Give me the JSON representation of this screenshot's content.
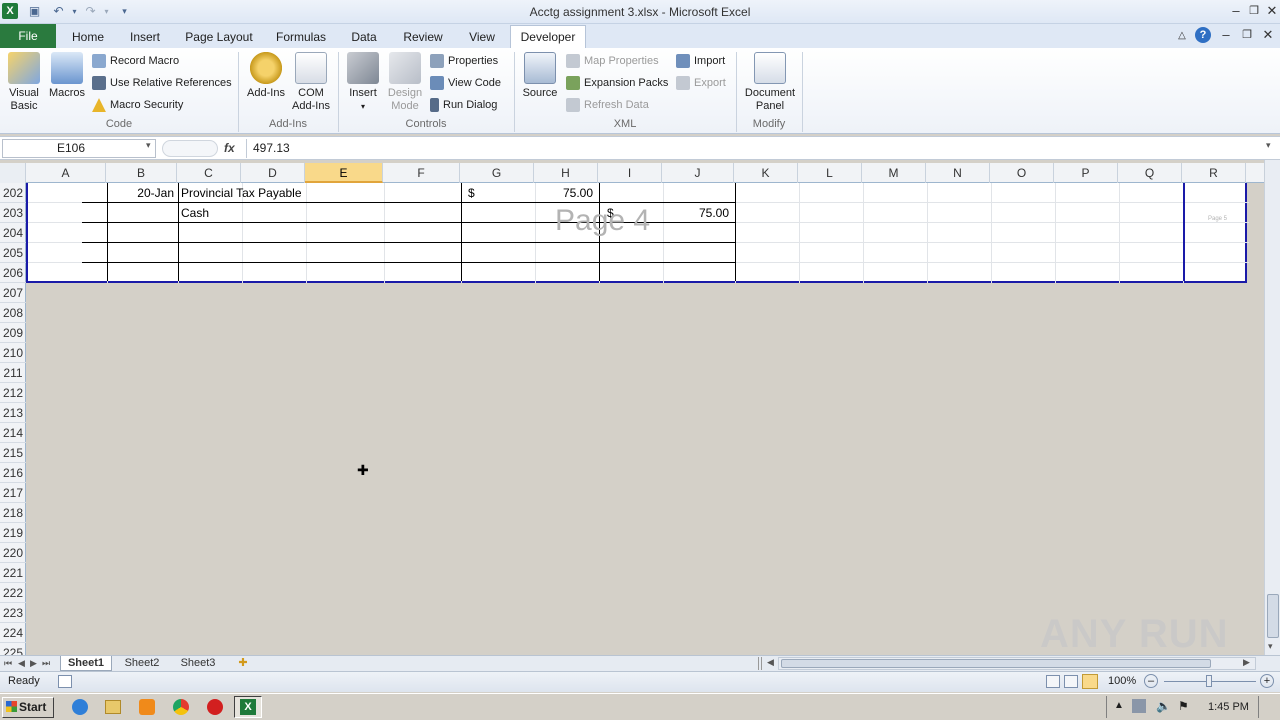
{
  "window": {
    "title": "Acctg assignment 3.xlsx - Microsoft Excel"
  },
  "tabs": [
    "File",
    "Home",
    "Insert",
    "Page Layout",
    "Formulas",
    "Data",
    "Review",
    "View",
    "Developer"
  ],
  "ribbon": {
    "code": {
      "label": "Code",
      "visual_basic": "Visual Basic",
      "macros": "Macros",
      "record_macro": "Record Macro",
      "relative_refs": "Use Relative References",
      "macro_security": "Macro Security"
    },
    "addins": {
      "label": "Add-Ins",
      "addins": "Add-Ins",
      "com_addins": "COM Add-Ins"
    },
    "controls": {
      "label": "Controls",
      "insert": "Insert",
      "design_mode": "Design Mode",
      "properties": "Properties",
      "view_code": "View Code",
      "run_dialog": "Run Dialog"
    },
    "xml": {
      "label": "XML",
      "source": "Source",
      "map_properties": "Map Properties",
      "expansion_packs": "Expansion Packs",
      "refresh_data": "Refresh Data",
      "import": "Import",
      "export": "Export"
    },
    "modify": {
      "label": "Modify",
      "document_panel": "Document Panel"
    }
  },
  "formula_bar": {
    "name_box": "E106",
    "fx": "fx",
    "value": "497.13"
  },
  "columns": [
    "A",
    "B",
    "C",
    "D",
    "E",
    "F",
    "G",
    "H",
    "I",
    "J",
    "K",
    "L",
    "M",
    "N",
    "O",
    "P",
    "Q",
    "R"
  ],
  "selected_column": "E",
  "rows": [
    "202",
    "203",
    "204",
    "205",
    "206",
    "207",
    "208",
    "209",
    "210",
    "211",
    "212",
    "213",
    "214",
    "215",
    "216",
    "217",
    "218",
    "219",
    "220",
    "221",
    "222",
    "223",
    "224",
    "225"
  ],
  "cells": {
    "b202": "20-Jan",
    "c202": "Provincial Tax Payable",
    "g202": "$",
    "h202": "75.00",
    "c203": "Cash",
    "i203": "$",
    "j203": "75.00"
  },
  "page_watermark": "Page 4",
  "page_watermark_small": "Page 5",
  "sheets": [
    "Sheet1",
    "Sheet2",
    "Sheet3"
  ],
  "active_sheet": "Sheet1",
  "status": {
    "ready": "Ready",
    "zoom": "100%"
  },
  "taskbar": {
    "start": "Start",
    "time": "1:45 PM"
  },
  "brand_watermark": "ANY RUN"
}
